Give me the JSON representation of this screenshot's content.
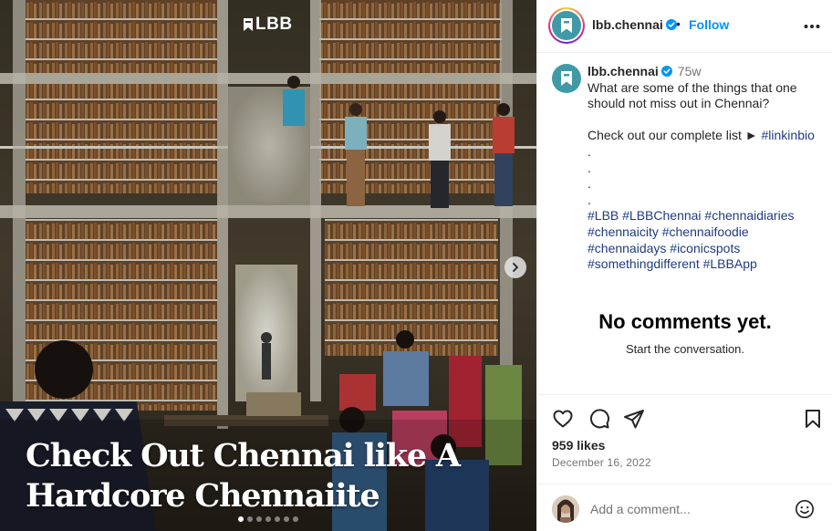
{
  "post": {
    "brand_logo": "LBB",
    "overlay_title_line1": "Check Out Chennai like A",
    "overlay_title_line2": "Hardcore Chennaiite",
    "carousel": {
      "slides": 7,
      "active": 1
    }
  },
  "header": {
    "username": "lbb.chennai",
    "separator": "•",
    "follow_label": "Follow",
    "more_label": "•••"
  },
  "caption": {
    "username": "lbb.chennai",
    "age": "75w",
    "lines": [
      "What are some of the things that one",
      "should not miss out in Chennai?"
    ],
    "cta_text": "Check out our complete list ► ",
    "cta_tag": "#linkinbio",
    "dots": [
      ".",
      ".",
      ".",
      "."
    ],
    "hashtag_lines": [
      "#LBB #LBBChennai #chennaidiaries",
      "#chennaicity #chennaifoodie",
      "#chennaidays #iconicspots",
      "#somethingdifferent #LBBApp"
    ]
  },
  "comments": {
    "empty_title": "No comments yet.",
    "empty_subtitle": "Start the conversation."
  },
  "stats": {
    "likes": "959 likes",
    "date": "December 16, 2022"
  },
  "comment_input": {
    "placeholder": "Add a comment..."
  },
  "icons": [
    "heart-icon",
    "comment-icon",
    "share-icon",
    "bookmark-icon",
    "emoji-icon",
    "verified-icon",
    "more-icon",
    "chevron-right-icon"
  ],
  "colors": {
    "link": "#0095f6",
    "hashtag": "#1f3b80",
    "avatar_bg": "#3f9aa6",
    "verified": "#0095f6"
  }
}
